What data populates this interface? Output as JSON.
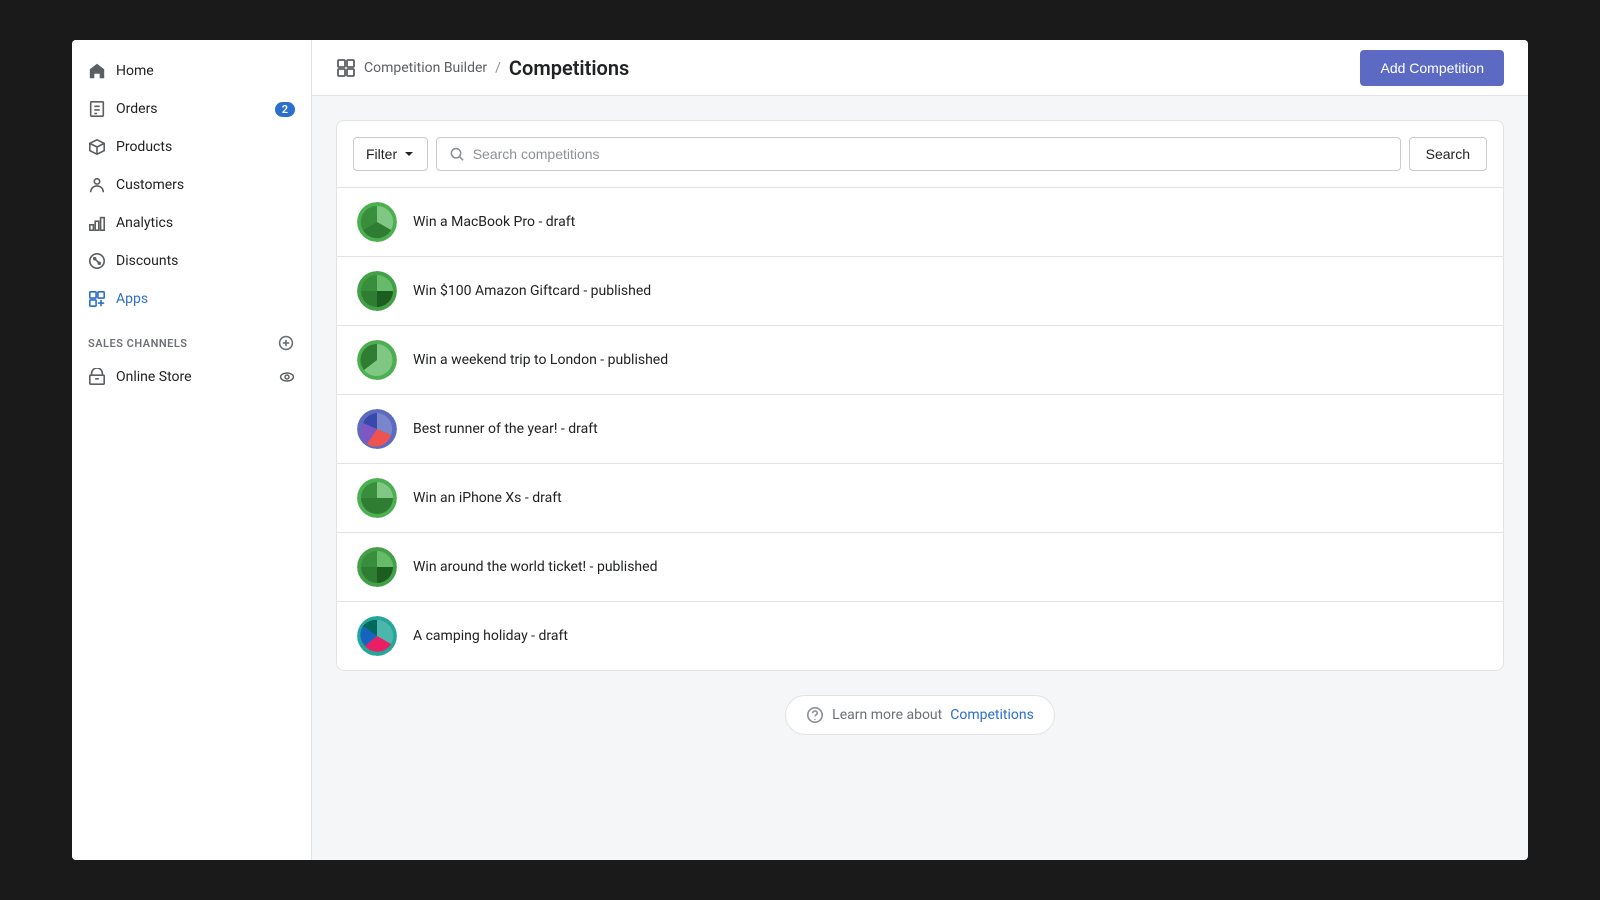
{
  "sidebar": {
    "nav_items": [
      {
        "id": "home",
        "label": "Home",
        "icon": "home"
      },
      {
        "id": "orders",
        "label": "Orders",
        "icon": "orders",
        "badge": "2"
      },
      {
        "id": "products",
        "label": "Products",
        "icon": "products"
      },
      {
        "id": "customers",
        "label": "Customers",
        "icon": "customers"
      },
      {
        "id": "analytics",
        "label": "Analytics",
        "icon": "analytics"
      },
      {
        "id": "discounts",
        "label": "Discounts",
        "icon": "discounts"
      },
      {
        "id": "apps",
        "label": "Apps",
        "icon": "apps",
        "active": true
      }
    ],
    "sales_channels_label": "SALES CHANNELS",
    "store_items": [
      {
        "id": "online-store",
        "label": "Online Store",
        "icon": "store"
      }
    ]
  },
  "topbar": {
    "app_name": "Competition Builder",
    "separator": "/",
    "page_title": "Competitions",
    "add_button_label": "Add Competition"
  },
  "search": {
    "filter_label": "Filter",
    "placeholder": "Search competitions",
    "search_button_label": "Search"
  },
  "competitions": [
    {
      "id": 1,
      "title": "Win a MacBook Pro - draft",
      "avatar_type": "pie-green"
    },
    {
      "id": 2,
      "title": "Win $100 Amazon Giftcard - published",
      "avatar_type": "pie-green"
    },
    {
      "id": 3,
      "title": "Win a weekend trip to London - published",
      "avatar_type": "pie-green"
    },
    {
      "id": 4,
      "title": "Best runner of the year! - draft",
      "avatar_type": "mixed"
    },
    {
      "id": 5,
      "title": "Win an iPhone Xs - draft",
      "avatar_type": "pie-green"
    },
    {
      "id": 6,
      "title": "Win around the world ticket! - published",
      "avatar_type": "pie-green"
    },
    {
      "id": 7,
      "title": "A camping holiday - draft",
      "avatar_type": "camping"
    }
  ],
  "help": {
    "text": "Learn more about",
    "link_label": "Competitions",
    "link_href": "#"
  }
}
